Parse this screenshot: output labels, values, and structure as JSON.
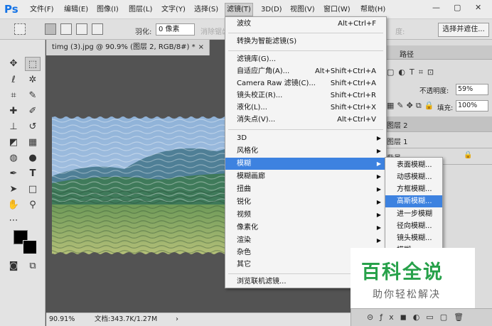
{
  "app": {
    "logo": "Ps"
  },
  "menubar": {
    "items": [
      "文件(F)",
      "编辑(E)",
      "图像(I)",
      "图层(L)",
      "文字(Y)",
      "选择(S)",
      "滤镜(T)",
      "3D(D)",
      "视图(V)",
      "窗口(W)",
      "帮助(H)"
    ],
    "active": "滤镜(T)"
  },
  "options": {
    "feather_label": "羽化:",
    "feather_value": "0 像素",
    "antialias_label": "消除锯齿",
    "opacity_fragment": "度:",
    "select_mask_button": "选择并遮住..."
  },
  "document": {
    "tab_title": "timg (3).jpg @ 90.9% (图层 2, RGB/8#) *",
    "tab_close": "×",
    "zoom": "90.91%",
    "doc_size": "文档:343.7K/1.27M"
  },
  "panels": {
    "tab_path": "路径",
    "opacity_label": "不透明度:",
    "opacity_value": "59%",
    "fill_label": "填充:",
    "fill_value": "100%",
    "layers": [
      "图层 2",
      "图层 1",
      "背景"
    ]
  },
  "filter_menu": {
    "groups": [
      [
        {
          "label": "波纹",
          "shortcut": "Alt+Ctrl+F"
        }
      ],
      [
        {
          "label": "转换为智能滤镜(S)",
          "shortcut": ""
        }
      ],
      [
        {
          "label": "滤镜库(G)...",
          "shortcut": ""
        },
        {
          "label": "自适应广角(A)...",
          "shortcut": "Alt+Shift+Ctrl+A"
        },
        {
          "label": "Camera Raw 滤镜(C)...",
          "shortcut": "Shift+Ctrl+A"
        },
        {
          "label": "镜头校正(R)...",
          "shortcut": "Shift+Ctrl+R"
        },
        {
          "label": "液化(L)...",
          "shortcut": "Shift+Ctrl+X"
        },
        {
          "label": "消失点(V)...",
          "shortcut": "Alt+Ctrl+V"
        }
      ],
      [
        {
          "label": "3D",
          "submenu": true
        },
        {
          "label": "风格化",
          "submenu": true
        },
        {
          "label": "模糊",
          "submenu": true,
          "highlighted": true
        },
        {
          "label": "模糊画廊",
          "submenu": true
        },
        {
          "label": "扭曲",
          "submenu": true
        },
        {
          "label": "锐化",
          "submenu": true
        },
        {
          "label": "视频",
          "submenu": true
        },
        {
          "label": "像素化",
          "submenu": true
        },
        {
          "label": "渲染",
          "submenu": true
        },
        {
          "label": "杂色",
          "submenu": true
        },
        {
          "label": "其它",
          "submenu": true
        }
      ],
      [
        {
          "label": "浏览联机滤镜...",
          "shortcut": ""
        }
      ]
    ]
  },
  "blur_submenu": {
    "items": [
      "表面模糊...",
      "动感模糊...",
      "方框模糊...",
      "高斯模糊...",
      "进一步模糊",
      "径向模糊...",
      "镜头模糊...",
      "模糊"
    ],
    "highlighted": "高斯模糊..."
  },
  "watermark": {
    "title": "百科全说",
    "subtitle": "助你轻松解决"
  },
  "colors": {
    "highlight": "#3d82e0",
    "ps_blue": "#1473e6",
    "watermark_green": "#27a14a"
  }
}
